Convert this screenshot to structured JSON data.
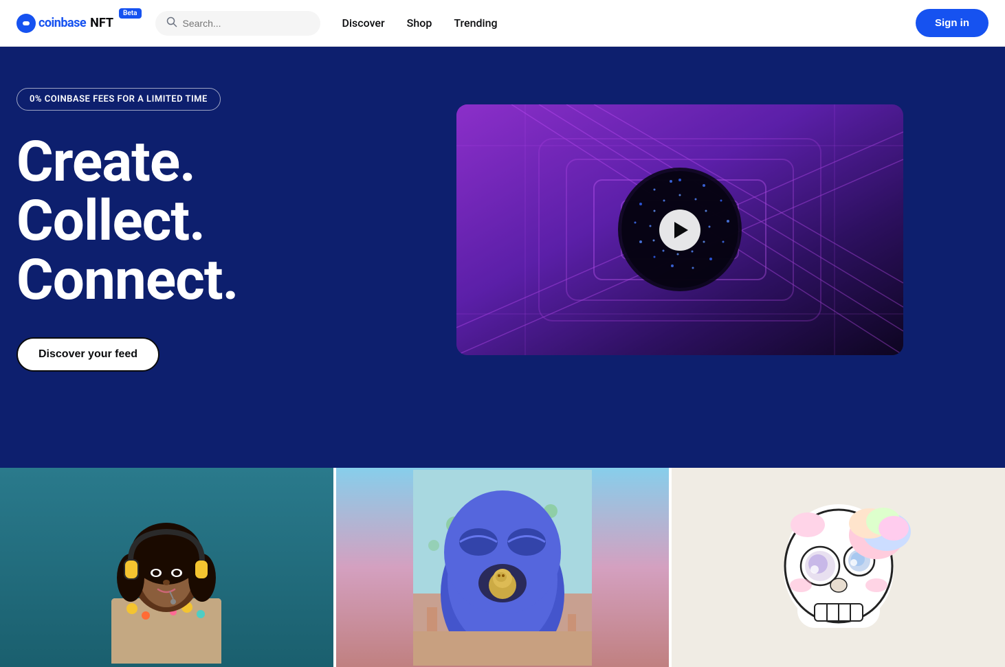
{
  "navbar": {
    "logo": {
      "coinbase": "coinbase",
      "nft": "NFT",
      "beta": "Beta"
    },
    "search": {
      "placeholder": "Search..."
    },
    "links": [
      {
        "label": "Discover",
        "id": "discover"
      },
      {
        "label": "Shop",
        "id": "shop"
      },
      {
        "label": "Trending",
        "id": "trending"
      }
    ],
    "signin_label": "Sign in"
  },
  "hero": {
    "fee_badge": "0% COINBASE FEES FOR A LIMITED TIME",
    "title_line1": "Create.",
    "title_line2": "Collect.",
    "title_line3": "Connect.",
    "cta_label": "Discover your feed",
    "video_play_label": "Play video"
  },
  "cards": [
    {
      "id": "card-1",
      "alt": "NFT artwork - woman with headphones"
    },
    {
      "id": "card-2",
      "alt": "NFT artwork - blue surreal creature"
    },
    {
      "id": "card-3",
      "alt": "NFT artwork - skull illustration"
    }
  ],
  "colors": {
    "brand_blue": "#1652f0",
    "hero_bg": "#0d1f6e",
    "white": "#ffffff"
  }
}
